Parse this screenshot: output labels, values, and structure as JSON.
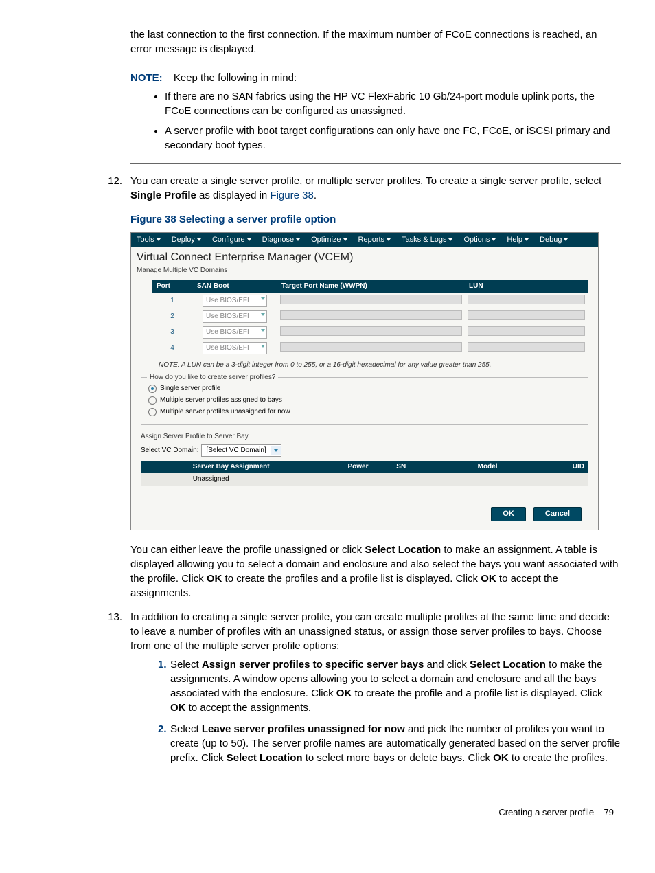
{
  "intro": "the last connection to the first connection. If the maximum number of FCoE connections is reached, an error message is displayed.",
  "note": {
    "label": "NOTE:",
    "lead": "Keep the following in mind:",
    "items": [
      "If there are no SAN fabrics using the HP VC FlexFabric 10 Gb/24-port module uplink ports, the FCoE connections can be configured as unassigned.",
      "A server profile with boot target configurations can only have one FC, FCoE, or iSCSI primary and secondary boot types."
    ]
  },
  "step12": {
    "num": "12.",
    "text_before": "You can create a single server profile, or multiple server profiles. To create a single server profile, select ",
    "bold1": "Single Profile",
    "text_mid": " as displayed in ",
    "link": "Figure 38",
    "text_after": "."
  },
  "figure": {
    "caption": "Figure 38 Selecting a server profile option",
    "menubar": [
      "Tools",
      "Deploy",
      "Configure",
      "Diagnose",
      "Optimize",
      "Reports",
      "Tasks & Logs",
      "Options",
      "Help",
      "Debug"
    ],
    "title": "Virtual Connect Enterprise Manager (VCEM)",
    "subtitle": "Manage Multiple VC Domains",
    "table": {
      "headers": [
        "Port",
        "SAN Boot",
        "Target Port Name (WWPN)",
        "LUN"
      ],
      "rows": [
        {
          "port": "1",
          "sanboot": "Use BIOS/EFI"
        },
        {
          "port": "2",
          "sanboot": "Use BIOS/EFI"
        },
        {
          "port": "3",
          "sanboot": "Use BIOS/EFI"
        },
        {
          "port": "4",
          "sanboot": "Use BIOS/EFI"
        }
      ]
    },
    "lun_note": "NOTE: A LUN can be a 3-digit integer from 0 to 255, or a 16-digit hexadecimal for any value greater than 255.",
    "fieldset": {
      "legend": "How do you like to create server profiles?",
      "options": [
        {
          "label": "Single server profile",
          "selected": true
        },
        {
          "label": "Multiple server profiles assigned to bays",
          "selected": false
        },
        {
          "label": "Multiple server profiles unassigned for now",
          "selected": false
        }
      ]
    },
    "assign_label": "Assign Server Profile to Server Bay",
    "domain_label": "Select VC Domain:",
    "domain_value": "[Select VC Domain]",
    "assign_headers": [
      "",
      "Server Bay Assignment",
      "Power",
      "SN",
      "Model",
      "UID"
    ],
    "assign_row": "Unassigned",
    "ok": "OK",
    "cancel": "Cancel"
  },
  "post12": {
    "t1": "You can either leave the profile unassigned or click ",
    "b1": "Select Location",
    "t2": " to make an assignment. A table is displayed allowing you to select a domain and enclosure and also select the bays you want associated with the profile. Click ",
    "b2": "OK",
    "t3": " to create the profiles and a profile list is displayed. Click ",
    "b3": "OK",
    "t4": " to accept the assignments."
  },
  "step13": {
    "num": "13.",
    "text": "In addition to creating a single server profile, you can create multiple profiles at the same time and decide to leave a number of profiles with an unassigned status, or assign those server profiles to bays. Choose from one of the multiple server profile options:",
    "sub": [
      {
        "n": "1.",
        "t1": "Select ",
        "b1": "Assign server profiles to specific server bays",
        "t2": " and click ",
        "b2": "Select Location",
        "t3": " to make the assignments. A window opens allowing you to select a domain and enclosure and all the bays associated with the enclosure. Click ",
        "b3": "OK",
        "t4": " to create the profile and a profile list is displayed. Click ",
        "b4": "OK",
        "t5": " to accept the assignments."
      },
      {
        "n": "2.",
        "t1": "Select ",
        "b1": "Leave server profiles unassigned for now",
        "t2": " and pick the number of profiles you want to create (up to 50). The server profile names are automatically generated based on the server profile prefix. Click ",
        "b2": "Select Location",
        "t3": " to select more bays or delete bays. Click ",
        "b3": "OK",
        "t4": " to create the profiles."
      }
    ]
  },
  "footer": {
    "title": "Creating a server profile",
    "page": "79"
  }
}
